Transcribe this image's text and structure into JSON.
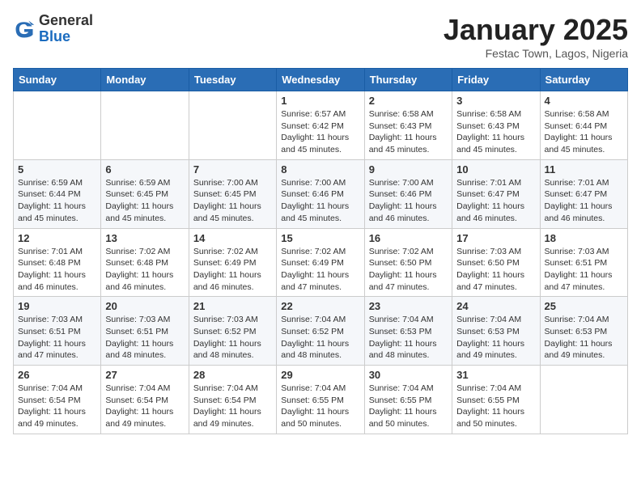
{
  "logo": {
    "general": "General",
    "blue": "Blue"
  },
  "header": {
    "month": "January 2025",
    "location": "Festac Town, Lagos, Nigeria"
  },
  "weekdays": [
    "Sunday",
    "Monday",
    "Tuesday",
    "Wednesday",
    "Thursday",
    "Friday",
    "Saturday"
  ],
  "weeks": [
    [
      {
        "day": "",
        "info": ""
      },
      {
        "day": "",
        "info": ""
      },
      {
        "day": "",
        "info": ""
      },
      {
        "day": "1",
        "info": "Sunrise: 6:57 AM\nSunset: 6:42 PM\nDaylight: 11 hours\nand 45 minutes."
      },
      {
        "day": "2",
        "info": "Sunrise: 6:58 AM\nSunset: 6:43 PM\nDaylight: 11 hours\nand 45 minutes."
      },
      {
        "day": "3",
        "info": "Sunrise: 6:58 AM\nSunset: 6:43 PM\nDaylight: 11 hours\nand 45 minutes."
      },
      {
        "day": "4",
        "info": "Sunrise: 6:58 AM\nSunset: 6:44 PM\nDaylight: 11 hours\nand 45 minutes."
      }
    ],
    [
      {
        "day": "5",
        "info": "Sunrise: 6:59 AM\nSunset: 6:44 PM\nDaylight: 11 hours\nand 45 minutes."
      },
      {
        "day": "6",
        "info": "Sunrise: 6:59 AM\nSunset: 6:45 PM\nDaylight: 11 hours\nand 45 minutes."
      },
      {
        "day": "7",
        "info": "Sunrise: 7:00 AM\nSunset: 6:45 PM\nDaylight: 11 hours\nand 45 minutes."
      },
      {
        "day": "8",
        "info": "Sunrise: 7:00 AM\nSunset: 6:46 PM\nDaylight: 11 hours\nand 45 minutes."
      },
      {
        "day": "9",
        "info": "Sunrise: 7:00 AM\nSunset: 6:46 PM\nDaylight: 11 hours\nand 46 minutes."
      },
      {
        "day": "10",
        "info": "Sunrise: 7:01 AM\nSunset: 6:47 PM\nDaylight: 11 hours\nand 46 minutes."
      },
      {
        "day": "11",
        "info": "Sunrise: 7:01 AM\nSunset: 6:47 PM\nDaylight: 11 hours\nand 46 minutes."
      }
    ],
    [
      {
        "day": "12",
        "info": "Sunrise: 7:01 AM\nSunset: 6:48 PM\nDaylight: 11 hours\nand 46 minutes."
      },
      {
        "day": "13",
        "info": "Sunrise: 7:02 AM\nSunset: 6:48 PM\nDaylight: 11 hours\nand 46 minutes."
      },
      {
        "day": "14",
        "info": "Sunrise: 7:02 AM\nSunset: 6:49 PM\nDaylight: 11 hours\nand 46 minutes."
      },
      {
        "day": "15",
        "info": "Sunrise: 7:02 AM\nSunset: 6:49 PM\nDaylight: 11 hours\nand 47 minutes."
      },
      {
        "day": "16",
        "info": "Sunrise: 7:02 AM\nSunset: 6:50 PM\nDaylight: 11 hours\nand 47 minutes."
      },
      {
        "day": "17",
        "info": "Sunrise: 7:03 AM\nSunset: 6:50 PM\nDaylight: 11 hours\nand 47 minutes."
      },
      {
        "day": "18",
        "info": "Sunrise: 7:03 AM\nSunset: 6:51 PM\nDaylight: 11 hours\nand 47 minutes."
      }
    ],
    [
      {
        "day": "19",
        "info": "Sunrise: 7:03 AM\nSunset: 6:51 PM\nDaylight: 11 hours\nand 47 minutes."
      },
      {
        "day": "20",
        "info": "Sunrise: 7:03 AM\nSunset: 6:51 PM\nDaylight: 11 hours\nand 48 minutes."
      },
      {
        "day": "21",
        "info": "Sunrise: 7:03 AM\nSunset: 6:52 PM\nDaylight: 11 hours\nand 48 minutes."
      },
      {
        "day": "22",
        "info": "Sunrise: 7:04 AM\nSunset: 6:52 PM\nDaylight: 11 hours\nand 48 minutes."
      },
      {
        "day": "23",
        "info": "Sunrise: 7:04 AM\nSunset: 6:53 PM\nDaylight: 11 hours\nand 48 minutes."
      },
      {
        "day": "24",
        "info": "Sunrise: 7:04 AM\nSunset: 6:53 PM\nDaylight: 11 hours\nand 49 minutes."
      },
      {
        "day": "25",
        "info": "Sunrise: 7:04 AM\nSunset: 6:53 PM\nDaylight: 11 hours\nand 49 minutes."
      }
    ],
    [
      {
        "day": "26",
        "info": "Sunrise: 7:04 AM\nSunset: 6:54 PM\nDaylight: 11 hours\nand 49 minutes."
      },
      {
        "day": "27",
        "info": "Sunrise: 7:04 AM\nSunset: 6:54 PM\nDaylight: 11 hours\nand 49 minutes."
      },
      {
        "day": "28",
        "info": "Sunrise: 7:04 AM\nSunset: 6:54 PM\nDaylight: 11 hours\nand 49 minutes."
      },
      {
        "day": "29",
        "info": "Sunrise: 7:04 AM\nSunset: 6:55 PM\nDaylight: 11 hours\nand 50 minutes."
      },
      {
        "day": "30",
        "info": "Sunrise: 7:04 AM\nSunset: 6:55 PM\nDaylight: 11 hours\nand 50 minutes."
      },
      {
        "day": "31",
        "info": "Sunrise: 7:04 AM\nSunset: 6:55 PM\nDaylight: 11 hours\nand 50 minutes."
      },
      {
        "day": "",
        "info": ""
      }
    ]
  ]
}
